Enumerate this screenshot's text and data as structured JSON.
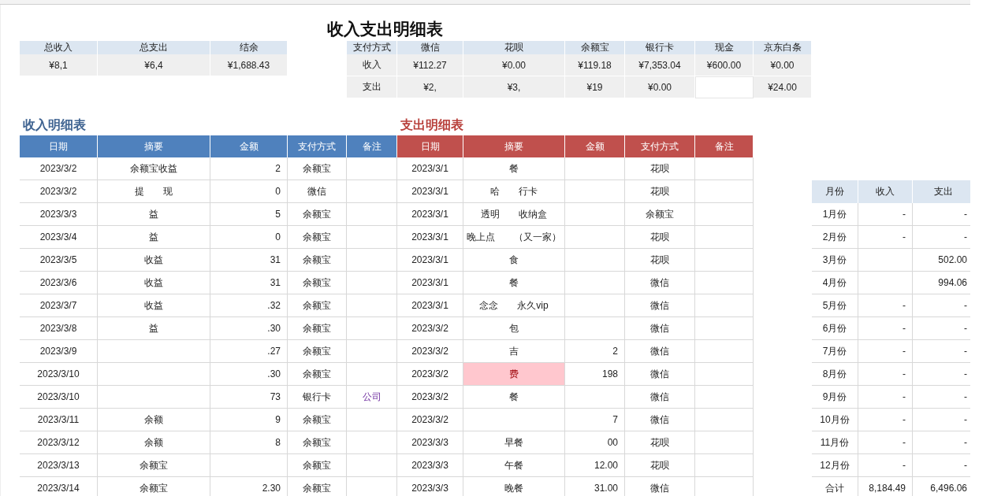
{
  "title": "收入支出明细表",
  "summary": [
    {
      "label": "总收入",
      "value": "¥8,1"
    },
    {
      "label": "总支出",
      "value": "¥6,4"
    },
    {
      "label": "结余",
      "value": "¥1,688.43"
    }
  ],
  "payment": {
    "corner": "支付方式",
    "methods": [
      "微信",
      "花呗",
      "余额宝",
      "银行卡",
      "现金",
      "京东白条"
    ],
    "rows": [
      {
        "label": "收入",
        "values": [
          {
            "text": "¥112.27"
          },
          {
            "text": "¥0.00"
          },
          {
            "text": "¥119.18"
          },
          {
            "text": "¥7,353.04"
          },
          {
            "text": "¥600.00"
          },
          {
            "text": "¥0.00"
          }
        ]
      },
      {
        "label": "支出",
        "values": [
          {
            "text": "¥2,"
          },
          {
            "text": "¥3,"
          },
          {
            "text": "¥19"
          },
          {
            "text": "¥0.00"
          },
          {
            "blank": true
          },
          {
            "text": "¥24.00"
          }
        ]
      }
    ]
  },
  "income": {
    "title": "收入明细表",
    "columns": [
      "日期",
      "摘要",
      "金额",
      "支付方式",
      "备注"
    ],
    "rows": [
      {
        "date": "2023/3/2",
        "summary": "余额宝收益",
        "amount": "2",
        "method": "余额宝"
      },
      {
        "date": "2023/3/2",
        "summary": "提　　现",
        "amount": "0",
        "method": "微信"
      },
      {
        "date": "2023/3/3",
        "summary": "益",
        "amount": "5",
        "method": "余额宝"
      },
      {
        "date": "2023/3/4",
        "summary": "益",
        "amount": "0",
        "method": "余额宝"
      },
      {
        "date": "2023/3/5",
        "summary": "收益",
        "amount": "31",
        "method": "余额宝"
      },
      {
        "date": "2023/3/6",
        "summary": "收益",
        "amount": "31",
        "method": "余额宝"
      },
      {
        "date": "2023/3/7",
        "summary": "收益",
        "amount": ".32",
        "method": "余额宝"
      },
      {
        "date": "2023/3/8",
        "summary": "益",
        "amount": ".30",
        "method": "余额宝"
      },
      {
        "date": "2023/3/9",
        "amount": ".27",
        "method": "余额宝"
      },
      {
        "date": "2023/3/10",
        "amount": ".30",
        "method": "余额宝"
      },
      {
        "date": "2023/3/10",
        "amount": "73",
        "method": "银行卡",
        "note": "公司"
      },
      {
        "date": "2023/3/11",
        "summary": "余额",
        "amount": "9",
        "method": "余额宝"
      },
      {
        "date": "2023/3/12",
        "summary": "余额",
        "amount": "8",
        "method": "余额宝"
      },
      {
        "date": "2023/3/13",
        "summary": "余额宝",
        "method": "余额宝"
      },
      {
        "date": "2023/3/14",
        "summary": "余额宝",
        "amount": "2.30",
        "method": "余额宝"
      }
    ]
  },
  "expense": {
    "title": "支出明细表",
    "columns": [
      "日期",
      "摘要",
      "金额",
      "支付方式",
      "备注"
    ],
    "rows": [
      {
        "date": "2023/3/1",
        "summary": "餐",
        "method": "花呗",
        "highlighted": false
      },
      {
        "date": "2023/3/1",
        "summary": "哈　　行卡",
        "method": "花呗",
        "highlighted": false
      },
      {
        "date": "2023/3/1",
        "summary": "透明　　收纳盒",
        "method": "余额宝",
        "highlighted": false
      },
      {
        "date": "2023/3/1",
        "summary": "晚上点　　（又一家）",
        "method": "花呗",
        "highlighted": false
      },
      {
        "date": "2023/3/1",
        "summary": "食",
        "method": "花呗",
        "highlighted": false
      },
      {
        "date": "2023/3/1",
        "summary": "餐",
        "method": "微信",
        "highlighted": false
      },
      {
        "date": "2023/3/1",
        "summary": "念念　　永久vip",
        "method": "微信",
        "highlighted": false
      },
      {
        "date": "2023/3/2",
        "summary": "包",
        "method": "微信",
        "highlighted": false
      },
      {
        "date": "2023/3/2",
        "summary": "吉",
        "amount": "2",
        "method": "微信",
        "highlighted": false
      },
      {
        "date": "2023/3/2",
        "summary": "费",
        "amount": "198",
        "method": "微信",
        "highlighted": true
      },
      {
        "date": "2023/3/2",
        "summary": "餐",
        "method": "微信",
        "highlighted": false
      },
      {
        "date": "2023/3/2",
        "amount": "7",
        "method": "微信",
        "highlighted": false
      },
      {
        "date": "2023/3/3",
        "summary": "早餐",
        "amount": "00",
        "method": "花呗",
        "highlighted": false
      },
      {
        "date": "2023/3/3",
        "summary": "午餐",
        "amount": "12.00",
        "method": "花呗",
        "highlighted": false
      },
      {
        "date": "2023/3/3",
        "summary": "晚餐",
        "amount": "31.00",
        "method": "微信",
        "highlighted": false
      }
    ]
  },
  "monthly": {
    "columns": [
      "月份",
      "收入",
      "支出"
    ],
    "rows": [
      {
        "month": "1月份",
        "income": "-",
        "expense": "-"
      },
      {
        "month": "2月份",
        "income": "-",
        "expense": "-"
      },
      {
        "month": "3月份",
        "expense": "502.00"
      },
      {
        "month": "4月份",
        "expense": "994.06"
      },
      {
        "month": "5月份",
        "income": "-",
        "expense": "-"
      },
      {
        "month": "6月份",
        "income": "-",
        "expense": "-"
      },
      {
        "month": "7月份",
        "income": "-",
        "expense": "-"
      },
      {
        "month": "8月份",
        "income": "-",
        "expense": "-"
      },
      {
        "month": "9月份",
        "income": "-",
        "expense": "-"
      },
      {
        "month": "10月份",
        "income": "-",
        "expense": "-"
      },
      {
        "month": "11月份",
        "income": "-",
        "expense": "-"
      },
      {
        "month": "12月份",
        "income": "-",
        "expense": "-"
      },
      {
        "month": "合计",
        "income": "8,184.49",
        "expense": "6,496.06"
      }
    ]
  }
}
